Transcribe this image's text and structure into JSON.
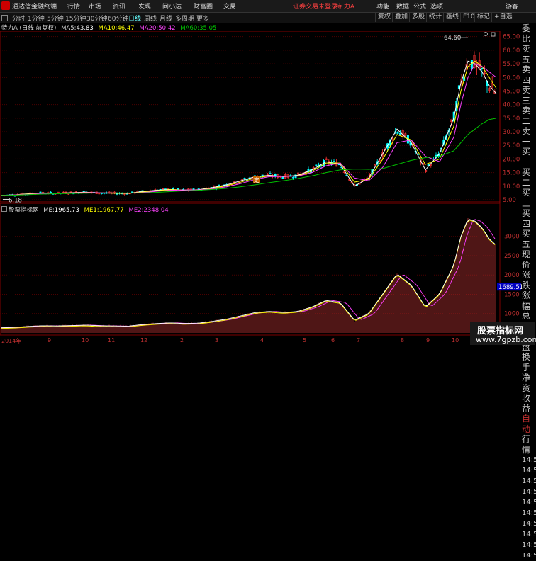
{
  "titlebar": {
    "app_title": "通达信金融终端",
    "menu": [
      "行情",
      "市场",
      "资讯",
      "发现",
      "问小达",
      "财富圈",
      "交易"
    ],
    "login_notice": "证券交易未登录",
    "stock_name": "特 力A",
    "right_menu": [
      "功能",
      "数据",
      "公式",
      "选项"
    ],
    "user": "游客"
  },
  "toolbar": {
    "periods": [
      "分时",
      "1分钟",
      "5分钟",
      "15分钟",
      "30分钟",
      "60分钟",
      "日线",
      "周线",
      "月线",
      "多周期",
      "更多"
    ],
    "active_period": "日线",
    "right_buttons": [
      "复权",
      "叠加",
      "多股",
      "统计",
      "画线",
      "F10",
      "标记",
      "+自选"
    ]
  },
  "info": {
    "stock": "特力A",
    "mode": "(日线 前复权)",
    "ma5_label": "MA5:",
    "ma5": "43.83",
    "ma10_label": "MA10:",
    "ma10": "46.47",
    "ma20_label": "MA20:",
    "ma20": "50.42",
    "ma60_label": "MA60:",
    "ma60": "35.05"
  },
  "colors": {
    "ma5": "#ffffff",
    "ma10": "#ffff00",
    "ma20": "#ff40ff",
    "ma60": "#00c000",
    "up": "#ff3333",
    "down": "#00ffff",
    "axis": "#c03030"
  },
  "price_axis": [
    "65.00",
    "60.00",
    "55.00",
    "50.00",
    "45.00",
    "40.00",
    "35.00",
    "30.00",
    "25.00",
    "20.00",
    "15.00",
    "10.00",
    "5.00"
  ],
  "annotations": {
    "high": "64.60",
    "low": "6.18",
    "marker": "定"
  },
  "indicator": {
    "title": "股票指标网",
    "me_label": "ME:",
    "me": "1965.73",
    "me1_label": "ME1:",
    "me1": "1967.77",
    "me2_label": "ME2:",
    "me2": "2348.04",
    "axis": [
      "3000",
      "2500",
      "2000",
      "1500",
      "1000"
    ],
    "current": "1689.51"
  },
  "right_panel": [
    "委比",
    "卖五",
    "卖四",
    "卖三",
    "卖二",
    "卖一",
    "买一",
    "买二",
    "买三",
    "买四",
    "买五",
    "现价",
    "涨跌",
    "涨幅",
    "总量",
    "外盘",
    "换手",
    "净资",
    "收益",
    "自动",
    "行情",
    "14:5",
    "14:5",
    "14:5",
    "14:5",
    "14:5",
    "14:5",
    "14:5",
    "14:5",
    "14:5",
    "14:5"
  ],
  "date_axis": [
    "2014年",
    "9",
    "10",
    "11",
    "12",
    "2",
    "3",
    "4",
    "5",
    "6",
    "7",
    "8",
    "9",
    "10"
  ],
  "watermark": {
    "line1": "股票指标网",
    "line2": "www.7gpzb.com"
  },
  "chart_data": {
    "type": "line",
    "title": "",
    "x": [
      1,
      20,
      40,
      60,
      80,
      100,
      120,
      140,
      160,
      180,
      200,
      220,
      240,
      260,
      280,
      300,
      320,
      340,
      360,
      380,
      400,
      420,
      440,
      460,
      480,
      500,
      520,
      540,
      560,
      580,
      600,
      620,
      640,
      650,
      660,
      670,
      680,
      690,
      700
    ],
    "series": [
      {
        "name": "MA5",
        "values": [
          6.6,
          6.8,
          7.2,
          7.5,
          7.4,
          7.6,
          7.8,
          7.5,
          7.4,
          7.3,
          8.0,
          8.5,
          8.8,
          8.5,
          8.7,
          9.5,
          10.5,
          12,
          13.5,
          14,
          13.5,
          14,
          16,
          19,
          18,
          10,
          13,
          22,
          31,
          26,
          16,
          22,
          35,
          48,
          56,
          55,
          52,
          47,
          44
        ]
      },
      {
        "name": "MA10",
        "values": [
          6.6,
          6.8,
          7.1,
          7.4,
          7.4,
          7.5,
          7.7,
          7.6,
          7.4,
          7.3,
          7.8,
          8.3,
          8.7,
          8.6,
          8.6,
          9.2,
          10.2,
          11.5,
          13,
          13.8,
          13.6,
          13.8,
          15.5,
          18.5,
          18.5,
          11.5,
          12.5,
          20,
          29,
          27,
          18,
          20,
          32,
          45,
          54,
          56,
          54,
          50,
          46
        ]
      },
      {
        "name": "MA20",
        "values": [
          6.6,
          6.8,
          7.0,
          7.3,
          7.4,
          7.5,
          7.6,
          7.6,
          7.5,
          7.4,
          7.6,
          8.1,
          8.5,
          8.6,
          8.6,
          9.0,
          9.8,
          11,
          12.5,
          13.5,
          13.6,
          13.7,
          15,
          17.5,
          18.5,
          13,
          12,
          17,
          26,
          27,
          21,
          19,
          28,
          40,
          50,
          55,
          54,
          52,
          50
        ]
      },
      {
        "name": "MA60",
        "values": [
          6.6,
          6.7,
          6.9,
          7.1,
          7.2,
          7.3,
          7.4,
          7.5,
          7.5,
          7.5,
          7.5,
          7.7,
          8.0,
          8.3,
          8.5,
          8.8,
          9.2,
          9.8,
          10.5,
          11.3,
          12,
          12.8,
          13.8,
          15,
          16,
          16.3,
          16.2,
          16.5,
          18,
          19.5,
          20.5,
          21,
          23,
          26,
          29,
          31,
          33,
          34.5,
          35
        ]
      }
    ],
    "ylim": [
      5,
      67
    ],
    "grid": true
  }
}
